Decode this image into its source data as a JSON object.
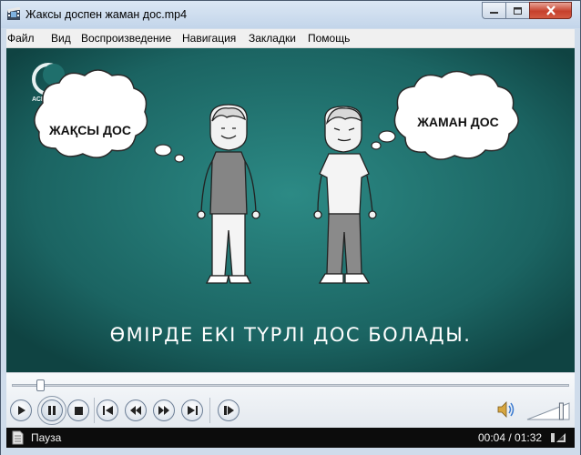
{
  "window": {
    "title": "Жаксы доспен жаман дос.mp4"
  },
  "menu": [
    "Файл",
    "Вид",
    "Воспроизведение",
    "Навигация",
    "Закладки",
    "Помощь"
  ],
  "video": {
    "logo_text": "АСЫЛ",
    "left_bubble": "ЖАҚСЫ ДОС",
    "right_bubble": "ЖАМАН ДОС",
    "subtitle": "ӨМІРДЕ ЕКІ ТҮРЛІ ДОС БОЛАДЫ.",
    "bg_color": "#1e6e6b"
  },
  "controls": {
    "seek_fraction": 0.05,
    "volume_fraction": 0.85,
    "buttons": [
      "play",
      "pause",
      "stop",
      "previous",
      "rewind",
      "forward",
      "next",
      "frame-step"
    ],
    "pressed_button": "pause"
  },
  "status": {
    "state": "Пауза",
    "time": "00:04 / 01:32"
  }
}
